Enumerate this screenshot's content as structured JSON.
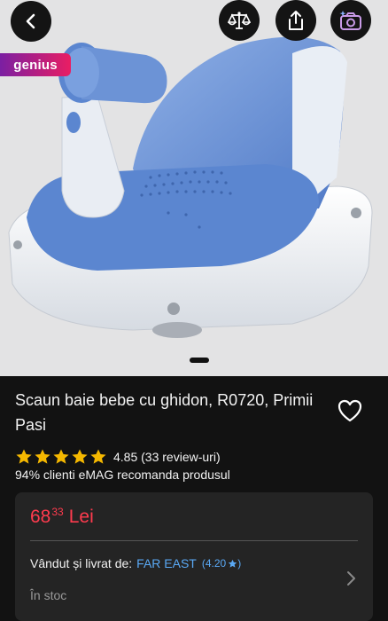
{
  "header": {
    "back_icon": "chevron-left-icon",
    "compare_icon": "scale-icon",
    "share_icon": "share-icon",
    "camera_icon": "camera-sparkle-icon",
    "genius_badge": "genius"
  },
  "gallery": {
    "current_index": 1
  },
  "product": {
    "title": "Scaun baie bebe cu ghidon, R0720, Primii Pasi",
    "rating_value": 4.85,
    "rating_text": "4.85 (33 review-uri)",
    "recommend_text": "94% clienti eMAG recomanda produsul"
  },
  "offer": {
    "price_int": "68",
    "price_cents": "33",
    "currency": "Lei",
    "seller_label": "Vândut și livrat de:",
    "seller_name": "FAR EAST",
    "seller_score": "(4.20",
    "stock": "În stoc"
  },
  "colors": {
    "price": "#ff3b4e",
    "link": "#5aa9f5",
    "star": "#f5b800",
    "genius_start": "#7b1fa2",
    "genius_end": "#e91e63"
  }
}
